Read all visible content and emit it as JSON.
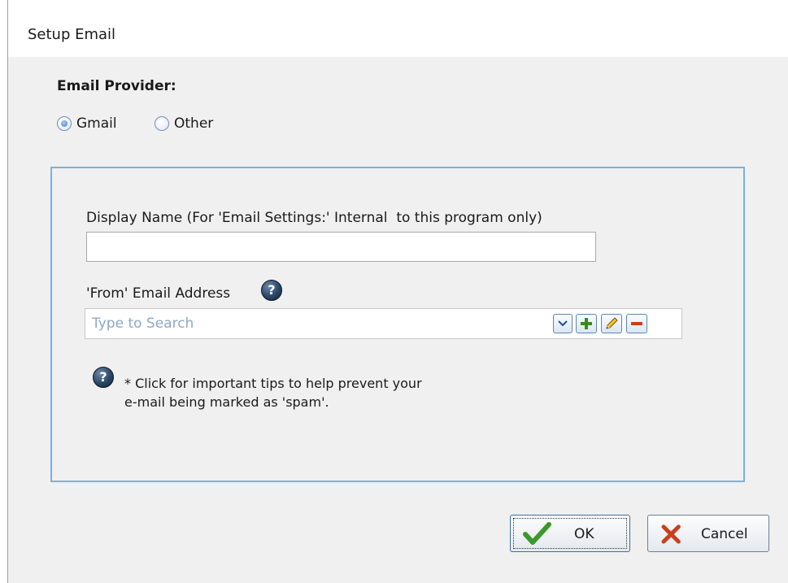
{
  "window": {
    "title": "Setup Email"
  },
  "provider": {
    "label": "Email Provider:",
    "options": [
      {
        "label": "Gmail",
        "selected": true
      },
      {
        "label": "Other",
        "selected": false
      }
    ]
  },
  "display_name": {
    "label": "Display Name (For 'Email Settings:' Internal  to this program only)",
    "value": ""
  },
  "from_address": {
    "label": "'From' Email Address",
    "placeholder": "Type to Search",
    "value": "",
    "buttons": {
      "dropdown_icon": "chevron-down-icon",
      "add_icon": "plus-icon",
      "edit_icon": "pencil-icon",
      "remove_icon": "minus-icon"
    }
  },
  "tips": {
    "text": "* Click for important tips to help prevent your e-mail being marked as 'spam'."
  },
  "help_icon_glyph": "?",
  "actions": {
    "ok_label": "OK",
    "cancel_label": "Cancel"
  },
  "colors": {
    "panel_border": "#7ab1dd",
    "placeholder": "#8fa9c6",
    "ok_check": "#3a9a2a",
    "cancel_x": "#c8401c"
  }
}
